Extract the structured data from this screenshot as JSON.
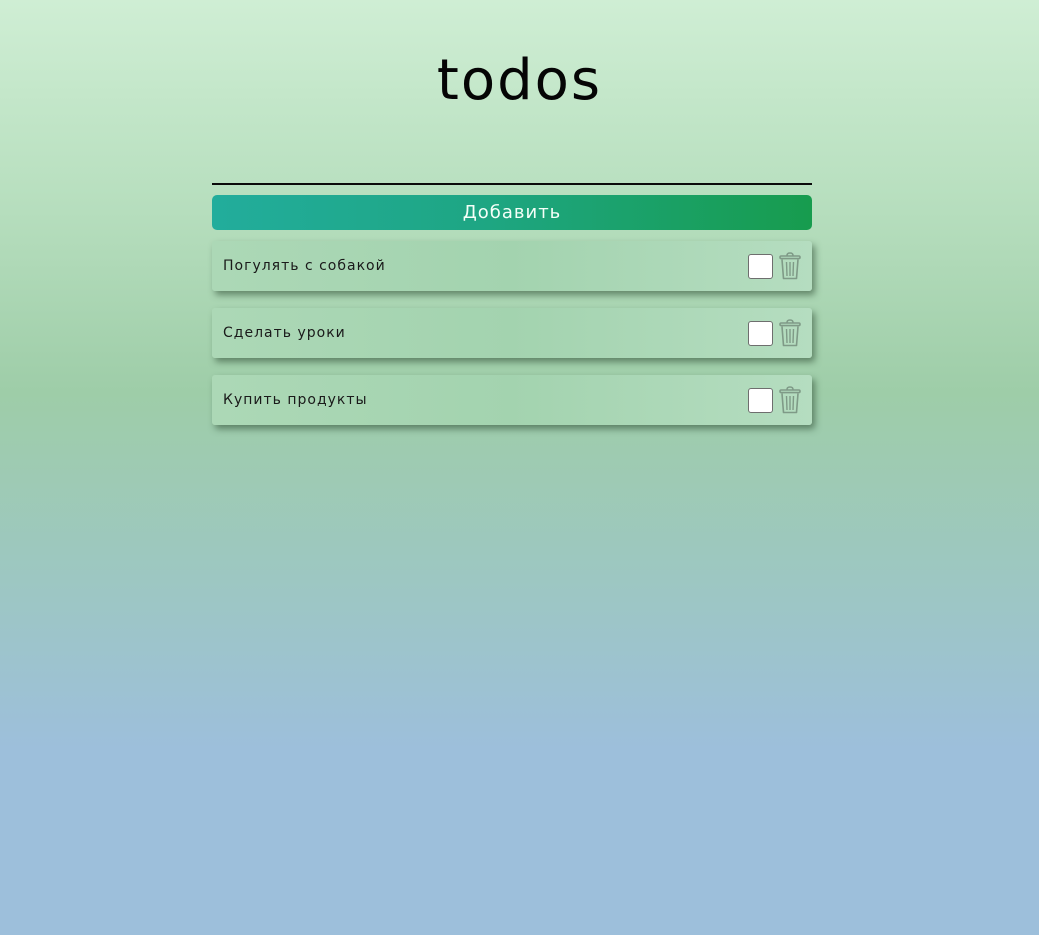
{
  "app": {
    "title": "todos"
  },
  "form": {
    "input_value": "",
    "input_placeholder": "",
    "add_button_label": "Добавить"
  },
  "todos": [
    {
      "text": "Погулять с собакой",
      "completed": false,
      "delete_icon": "trash-icon"
    },
    {
      "text": "Сделать уроки",
      "completed": false,
      "delete_icon": "trash-icon"
    },
    {
      "text": "Купить продукты",
      "completed": false,
      "delete_icon": "trash-icon"
    }
  ],
  "colors": {
    "accent_start": "#22ad9c",
    "accent_end": "#179c4e",
    "icon_gray": "#7f9a87"
  }
}
